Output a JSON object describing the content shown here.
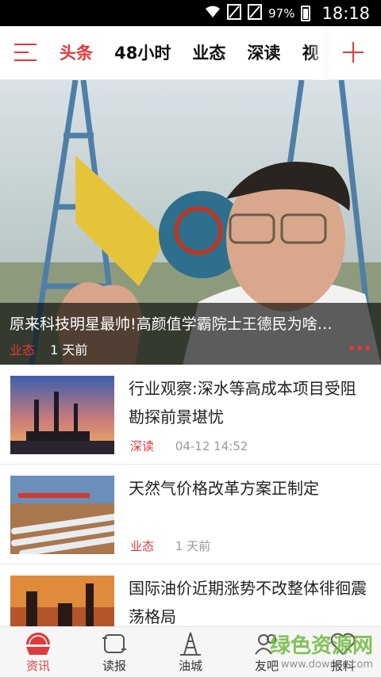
{
  "status_bar": {
    "battery": "97%",
    "time": "18:18"
  },
  "nav": {
    "tabs": [
      {
        "label": "头条",
        "active": true
      },
      {
        "label": "48小时",
        "active": false
      },
      {
        "label": "业态",
        "active": false
      },
      {
        "label": "深读",
        "active": false
      },
      {
        "label": "视",
        "active": false
      }
    ]
  },
  "hero": {
    "title": "原来科技明星最帅!高颜值学霸院士王德民为啥…",
    "category": "业态",
    "time": "1 天前",
    "slide_count": 3
  },
  "news": [
    {
      "title": "行业观察:深水等高成本项目受阻 勘探前景堪忧",
      "category": "深读",
      "time": "04-12 14:52"
    },
    {
      "title": "天然气价格改革方案正制定",
      "category": "业态",
      "time": "1 天前"
    },
    {
      "title": "国际油价近期涨势不改整体徘徊震荡格局",
      "category": "",
      "time": ""
    }
  ],
  "bottom_bar": [
    {
      "label": "资讯",
      "icon": "news-icon",
      "active": true
    },
    {
      "label": "读报",
      "icon": "newspaper-icon",
      "active": false
    },
    {
      "label": "油城",
      "icon": "oil-derrick-icon",
      "active": false
    },
    {
      "label": "友吧",
      "icon": "friends-icon",
      "active": false
    },
    {
      "label": "报料",
      "icon": "report-icon",
      "active": false
    }
  ],
  "watermark": {
    "text": "绿色资源网",
    "sub": "www.downcc.com"
  },
  "colors": {
    "accent": "#e03a3a"
  }
}
